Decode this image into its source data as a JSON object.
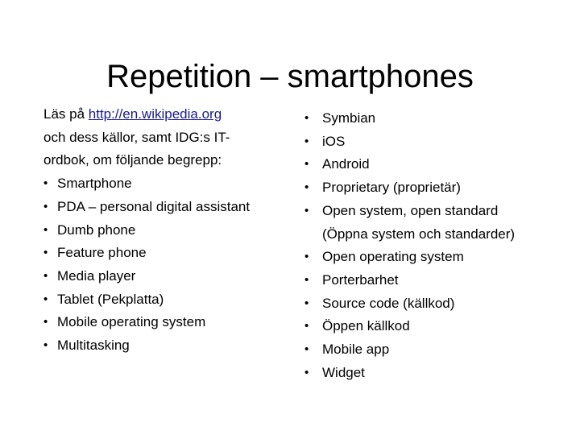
{
  "slide": {
    "title": "Repetition – smartphones",
    "left": {
      "intro_prefix": "Läs på ",
      "intro_link": "http://en.wikipedia.org",
      "intro_line2": "och dess källor, samt IDG:s IT-",
      "intro_line3": "ordbok, om följande begrepp:",
      "bullet_glyph": "•",
      "items": [
        "Smartphone",
        "PDA – personal digital assistant",
        "Dumb phone",
        "Feature phone",
        "Media player",
        "Tablet (Pekplatta)",
        "Mobile operating system",
        "Multitasking"
      ]
    },
    "right": {
      "bullet_glyph": "•",
      "items": [
        {
          "line1": "Symbian"
        },
        {
          "line1": "iOS"
        },
        {
          "line1": "Android"
        },
        {
          "line1": "Proprietary (proprietär)"
        },
        {
          "line1": "Open system, open standard",
          "line2": "(Öppna system och standarder)"
        },
        {
          "line1": "Open operating system"
        },
        {
          "line1": "Porterbarhet"
        },
        {
          "line1": "Source code (källkod)"
        },
        {
          "line1": "Öppen källkod"
        },
        {
          "line1": "Mobile app"
        },
        {
          "line1": "Widget"
        }
      ]
    },
    "colors": {
      "text": "#000000",
      "link": "#1a1a8c",
      "background": "#ffffff"
    }
  }
}
